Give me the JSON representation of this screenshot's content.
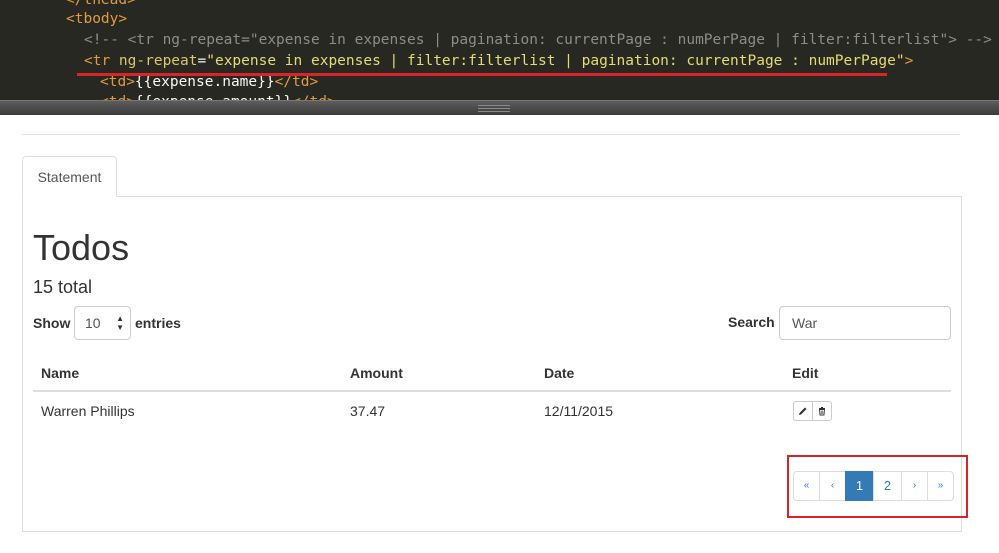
{
  "editor": {
    "lines": [
      {
        "parts": [
          [
            "tag",
            "</thead>"
          ]
        ]
      },
      {
        "parts": [
          [
            "tag",
            "<tbody>"
          ]
        ]
      },
      {
        "parts": [
          [
            "comment",
            "<!-- <tr ng-repeat=\"expense in expenses | pagination: currentPage : numPerPage | filter:filterlist\"> -->"
          ]
        ]
      },
      {
        "parts": [
          [
            "tag",
            "<tr "
          ],
          [
            "attr",
            "ng-repeat"
          ],
          [
            "plain",
            "="
          ],
          [
            "str",
            "\"expense in expenses | filter:filterlist | pagination: currentPage : numPerPage\""
          ],
          [
            "tag",
            ">"
          ]
        ]
      },
      {
        "parts": [
          [
            "tag",
            "<td>"
          ],
          [
            "plain",
            "{{expense.name}}"
          ],
          [
            "tag",
            "</td>"
          ]
        ]
      },
      {
        "parts": [
          [
            "tag",
            "<td>"
          ],
          [
            "plain",
            "{{expense.amount}}"
          ],
          [
            "tag",
            "</td>"
          ]
        ]
      }
    ]
  },
  "tab": {
    "label": "Statement"
  },
  "heading": {
    "title": "Todos",
    "total": "15 total"
  },
  "controls": {
    "show_label": "Show",
    "page_size": "10",
    "entries_label": "entries",
    "search_label": "Search",
    "search_value": "War"
  },
  "table": {
    "headers": [
      "Name",
      "Amount",
      "Date",
      "Edit"
    ],
    "rows": [
      {
        "name": "Warren Phillips",
        "amount": "37.47",
        "date": "12/11/2015"
      }
    ]
  },
  "pagination": {
    "first": "«",
    "prev": "‹",
    "pages": [
      "1",
      "2"
    ],
    "current": "1",
    "next": "›",
    "last": "»"
  },
  "icons": {
    "edit": "pencil-icon",
    "delete": "trash-icon",
    "select_arrows": "updown-arrows-icon"
  },
  "colors": {
    "accent": "#337ab7",
    "highlight": "#d9242c",
    "editor_bg": "#272822"
  }
}
